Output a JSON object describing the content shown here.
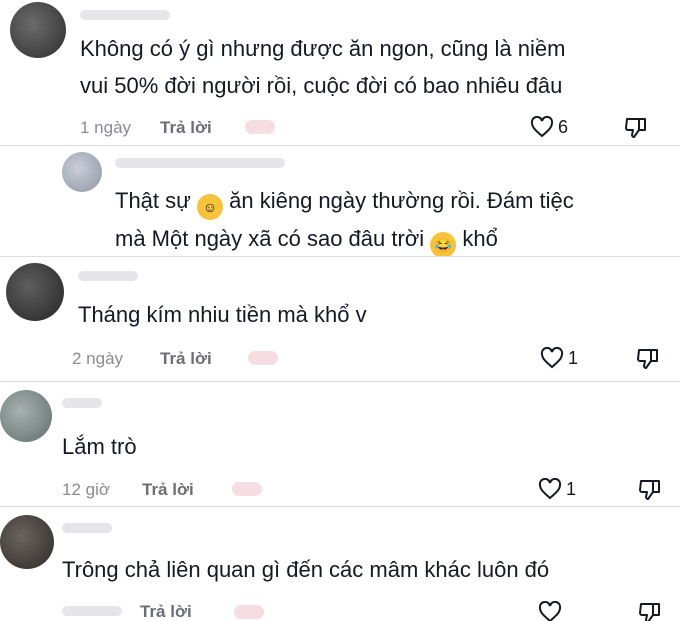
{
  "comments": [
    {
      "text_lines": [
        "Không có ý gì nhưng được ăn ngon, cũng là niềm",
        "vui 50% đời người rồi, cuộc đời có bao nhiêu đâu"
      ],
      "time": "1 ngày",
      "reply_label": "Trả lời",
      "likes": "6"
    },
    {
      "text_line1_a": "Thật sự",
      "text_line1_b": "ăn kiêng ngày thường rồi. Đám tiệc",
      "text_line2_a": "mà Một ngày xã có sao đâu trời",
      "text_line2_b": "khổ",
      "emoji1": "blushing-hand-over-mouth-emoji",
      "emoji2": "laughing-tears-emoji"
    },
    {
      "text": "Tháng kím nhiu tiền mà khổ v",
      "time": "2 ngày",
      "reply_label": "Trả lời",
      "likes": "1"
    },
    {
      "text": "Lắm trò",
      "time": "12 giờ",
      "reply_label": "Trả lời",
      "likes": "1"
    },
    {
      "text": "Trông chả liên quan gì đến các mâm khác luôn đó",
      "reply_label": "Trả lời"
    }
  ],
  "colors": {
    "text": "#161823",
    "meta": "#8a8b91",
    "strip_border": "#dcdcdc"
  }
}
